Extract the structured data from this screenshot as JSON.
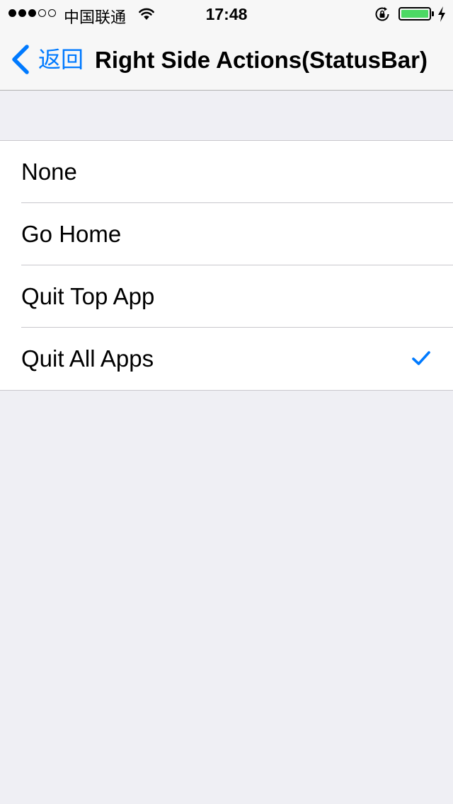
{
  "status_bar": {
    "carrier": "中国联通",
    "time": "17:48",
    "battery_level": 1.0,
    "signal_bars_filled": 3,
    "signal_bars_total": 5,
    "icons": [
      "signal-dots-icon",
      "wifi-icon",
      "rotation-lock-icon",
      "battery-icon",
      "charging-bolt-icon"
    ],
    "battery_color": "#4CD964"
  },
  "nav_bar": {
    "back_label": "返回",
    "title": "Right Side Actions(StatusBar)",
    "tint_color": "#007AFF"
  },
  "options": [
    {
      "label": "None",
      "selected": false
    },
    {
      "label": "Go Home",
      "selected": false
    },
    {
      "label": "Quit Top App",
      "selected": false
    },
    {
      "label": "Quit All Apps",
      "selected": true
    }
  ]
}
